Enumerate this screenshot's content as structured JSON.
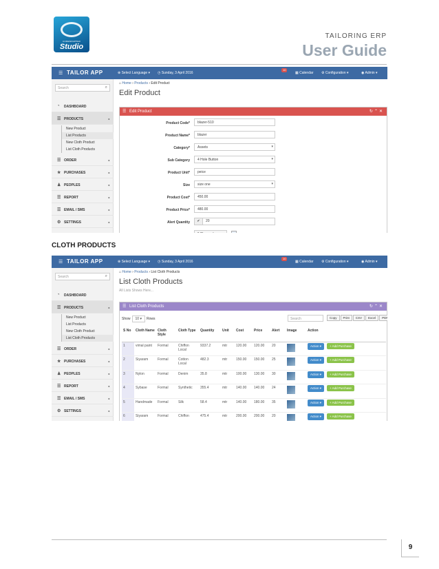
{
  "doc": {
    "subtitle": "TAILORING ERP",
    "title": "User Guide",
    "logo_small": "CODEWRAPPER",
    "logo_text": "Studio",
    "section_heading": "CLOTH PRODUCTS",
    "page_number": "9"
  },
  "topbar": {
    "brand": "TAILOR APP",
    "language": "Select Language",
    "date": "Sunday, 3 April 2016",
    "badge": "10",
    "calendar": "Calendar",
    "configuration": "Configuration",
    "admin": "Admin"
  },
  "sidebar": {
    "search_placeholder": "Search",
    "items": [
      {
        "label": "DASHBOARD",
        "icon": "dashboard-icon"
      },
      {
        "label": "PRODUCTS",
        "icon": "list-icon"
      },
      {
        "label": "ORDER",
        "icon": "list-icon"
      },
      {
        "label": "PURCHASES",
        "icon": "star-icon"
      },
      {
        "label": "PEOPLES",
        "icon": "users-icon"
      },
      {
        "label": "REPORT",
        "icon": "list-icon"
      },
      {
        "label": "EMAIL / SMS",
        "icon": "list-icon"
      },
      {
        "label": "SETTINGS",
        "icon": "gears-icon"
      }
    ],
    "subitems": [
      "New Product",
      "List Products",
      "New Cloth Product",
      "List Cloth Products"
    ]
  },
  "edit": {
    "crumb_home": "Home",
    "crumb_products": "Products",
    "crumb_current": "Edit Product",
    "title": "Edit Product",
    "panel_title": "Edit Product",
    "fields": [
      {
        "label": "Product Code*",
        "value": "blazer-510",
        "type": "text"
      },
      {
        "label": "Product Name*",
        "value": "blazer",
        "type": "text"
      },
      {
        "label": "Category*",
        "value": "Assets",
        "type": "select"
      },
      {
        "label": "Sub Category",
        "value": "4 Hole Button",
        "type": "select"
      },
      {
        "label": "Product Unit*",
        "value": "peice",
        "type": "text"
      },
      {
        "label": "Size",
        "value": "size one",
        "type": "select"
      },
      {
        "label": "Product Cost*",
        "value": "450.00",
        "type": "text"
      },
      {
        "label": "Product Price*",
        "value": "480.00",
        "type": "text"
      },
      {
        "label": "Alert Quantity",
        "value": "20",
        "type": "check"
      },
      {
        "label": "Image",
        "value": "Choose Image",
        "type": "file"
      }
    ]
  },
  "list": {
    "crumb_home": "Home",
    "crumb_products": "Products",
    "crumb_current": "List Cloth Products",
    "title": "List Cloth Products",
    "subtitle": "All Lists Shows Here...",
    "panel_title": "List Cloth Products",
    "show": "Show",
    "rows_value": "10",
    "rows": "Rows",
    "search_placeholder": "Search",
    "export_buttons": [
      "Copy",
      "Print",
      "CSV",
      "Excel",
      "PDF"
    ],
    "headers": [
      "S No",
      "Cloth Name",
      "Cloth Style",
      "Cloth Type",
      "Quantity",
      "Unit",
      "Cost",
      "Price",
      "Alert",
      "Image",
      "Action"
    ],
    "action_label": "Action",
    "add_purchase": "+ Add Purchase",
    "rows_data": [
      [
        "1",
        "vimal paint",
        "Formal",
        "Chiffon Local",
        "9337.2",
        "mtr",
        "120.00",
        "120.00",
        "20"
      ],
      [
        "2",
        "Siyaram",
        "Formal",
        "Cotton Local",
        "482.3",
        "mtr",
        "150.00",
        "150.00",
        "25"
      ],
      [
        "3",
        "Nylon",
        "Formal",
        "Denim",
        "35.8",
        "mtr",
        "100.00",
        "130.00",
        "30"
      ],
      [
        "4",
        "Sybase",
        "Formal",
        "Synthetic",
        "355.4",
        "mtr",
        "140.00",
        "140.00",
        "24"
      ],
      [
        "5",
        "Handmade",
        "Formal",
        "Silk",
        "58.4",
        "mtr",
        "140.00",
        "180.00",
        "35"
      ],
      [
        "6",
        "Siyaram",
        "Formal",
        "Chiffon",
        "475.4",
        "mtr",
        "200.00",
        "200.00",
        "20"
      ]
    ]
  },
  "colors": {
    "topbar": "#3d6aa3",
    "edit_panel": "#d9534f",
    "list_panel": "#9b87c9",
    "add_button": "#8bc34a",
    "action_button": "#428bca"
  }
}
